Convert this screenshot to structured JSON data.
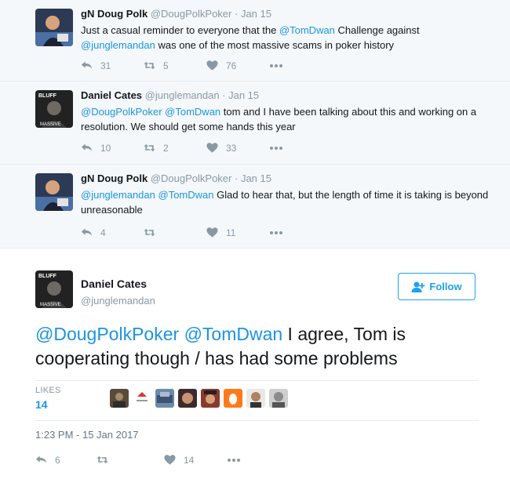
{
  "tweets": [
    {
      "name": "gN Doug Polk",
      "handle": "@DougPolkPoker",
      "date": "· Jan 15",
      "text_1": "Just a casual reminder to everyone that the ",
      "mention_1": "@TomDwan",
      "text_2": " Challenge against",
      "mention_2": "@junglemandan",
      "text_3": " was one of the most massive scams in poker history",
      "replies": "31",
      "retweets": "5",
      "likes": "76"
    },
    {
      "name": "Daniel Cates",
      "handle": "@junglemandan",
      "date": "· Jan 15",
      "mention_1": "@DougPolkPoker",
      "mention_2": "@TomDwan",
      "text_1": " tom and I have been talking about this and working on a resolution. We should get some hands this year",
      "replies": "10",
      "retweets": "2",
      "likes": "33"
    },
    {
      "name": "gN Doug Polk",
      "handle": "@DougPolkPoker",
      "date": "· Jan 15",
      "mention_1": "@junglemandan",
      "mention_2": "@TomDwan",
      "text_1": " Glad to hear that, but the length of time it is taking is beyond unreasonable",
      "replies": "4",
      "retweets": "",
      "likes": "11"
    }
  ],
  "main": {
    "name": "Daniel Cates",
    "handle": "@junglemandan",
    "follow_label": "Follow",
    "mention_1": "@DougPolkPoker",
    "mention_2": "@TomDwan",
    "text": " I agree, Tom is cooperating though / has had some problems",
    "likes_label": "LIKES",
    "likes_count": "14",
    "timestamp": "1:23 PM - 15 Jan 2017",
    "replies": "6",
    "retweets": "",
    "likes": "14"
  },
  "colors": {
    "link": "#1b95e0",
    "muted": "#8899a6",
    "follow": "#1da1f2",
    "avatar_bluff_text": "#ffffff"
  },
  "avatar_bluff": {
    "top": "BLUFF",
    "bottom": "MASSIVE"
  }
}
